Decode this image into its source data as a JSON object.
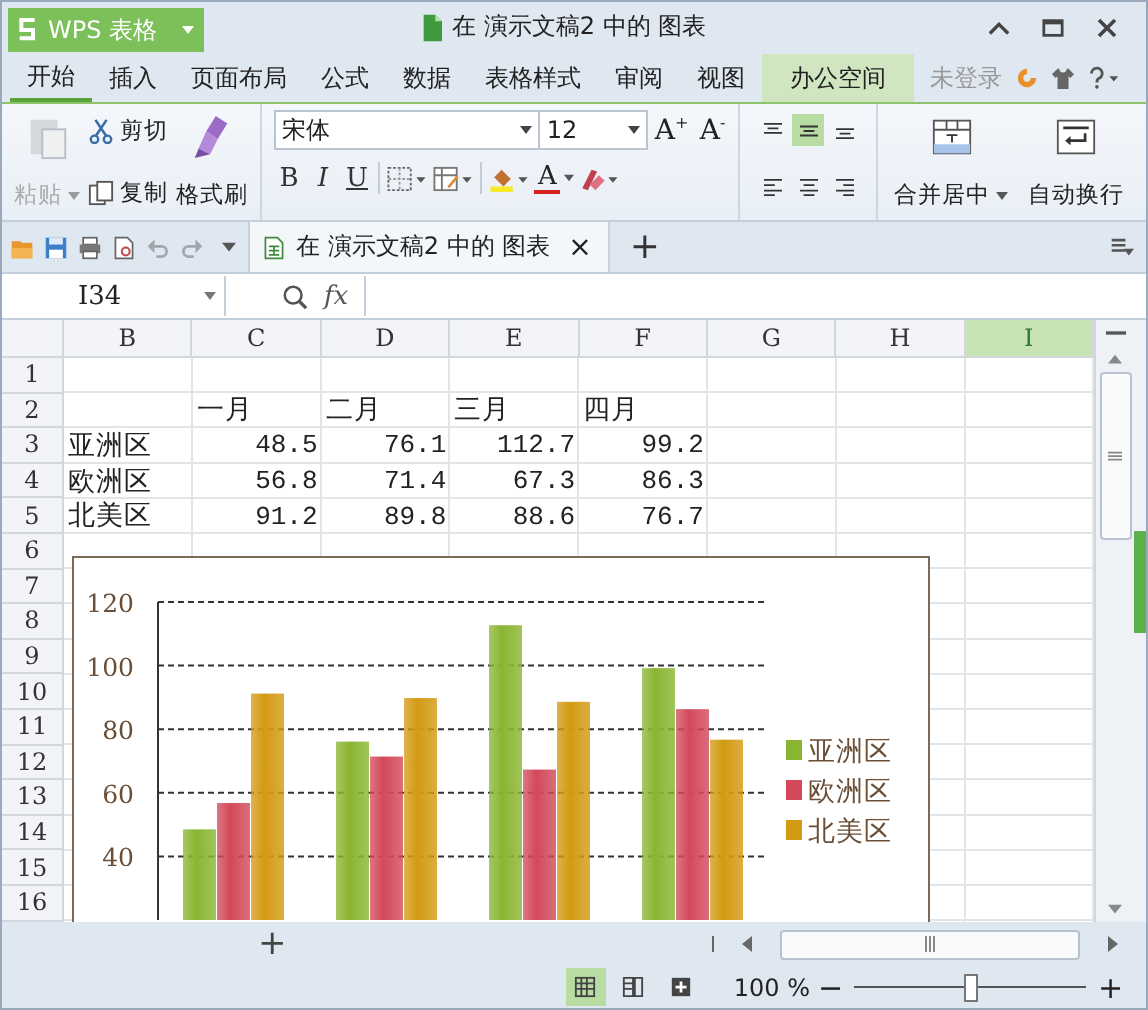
{
  "app_button": {
    "label": "WPS 表格"
  },
  "window": {
    "title": "在 演示文稿2 中的 图表"
  },
  "menu_tabs": [
    {
      "label": "开始",
      "selected": true,
      "highlighted": false
    },
    {
      "label": "插入",
      "selected": false,
      "highlighted": false
    },
    {
      "label": "页面布局",
      "selected": false,
      "highlighted": false
    },
    {
      "label": "公式",
      "selected": false,
      "highlighted": false
    },
    {
      "label": "数据",
      "selected": false,
      "highlighted": false
    },
    {
      "label": "表格样式",
      "selected": false,
      "highlighted": false
    },
    {
      "label": "审阅",
      "selected": false,
      "highlighted": false
    },
    {
      "label": "视图",
      "selected": false,
      "highlighted": false
    },
    {
      "label": "办公空间",
      "selected": false,
      "highlighted": true
    }
  ],
  "account": {
    "label": "未登录"
  },
  "ribbon": {
    "paste": {
      "label": "粘贴",
      "disabled": true
    },
    "cut": "剪切",
    "copy": "复制",
    "format_painter": "格式刷",
    "font": {
      "value": "宋体"
    },
    "font_size": {
      "value": "12"
    },
    "grow_font": "A$^{+}$",
    "shrink_font": "A$^{-}$",
    "bold": "B",
    "italic": "I",
    "underline": "U",
    "font_color": "A",
    "align_buttons": [
      {
        "kind": "top",
        "selected": false
      },
      {
        "kind": "middle",
        "selected": true
      },
      {
        "kind": "bottom",
        "selected": false
      },
      {
        "kind": "left",
        "selected": false
      },
      {
        "kind": "center",
        "selected": false
      },
      {
        "kind": "right",
        "selected": false
      }
    ],
    "merge": "合并居中",
    "wrap": "自动换行"
  },
  "quick_access": [
    {
      "kind": "open",
      "disabled": false
    },
    {
      "kind": "save",
      "disabled": false
    },
    {
      "kind": "print",
      "disabled": false
    },
    {
      "kind": "preview",
      "disabled": false
    },
    {
      "kind": "undo",
      "disabled": true
    },
    {
      "kind": "redo",
      "disabled": true
    }
  ],
  "doc_tab": {
    "title": "在 演示文稿2 中的 图表",
    "close": "×"
  },
  "new_tab": "+",
  "formula_bar": {
    "name_box": "I34",
    "fx": "fx"
  },
  "sheet": {
    "columns": [
      {
        "label": "B",
        "selected": false
      },
      {
        "label": "C",
        "selected": false
      },
      {
        "label": "D",
        "selected": false
      },
      {
        "label": "E",
        "selected": false
      },
      {
        "label": "F",
        "selected": false
      },
      {
        "label": "G",
        "selected": false
      },
      {
        "label": "H",
        "selected": false
      },
      {
        "label": "I",
        "selected": true
      }
    ],
    "rows": [
      "1",
      "2",
      "3",
      "4",
      "5",
      "6",
      "7",
      "8",
      "9",
      "10",
      "11",
      "12",
      "13",
      "14",
      "15",
      "16"
    ],
    "table": {
      "header": [
        "一月",
        "二月",
        "三月",
        "四月"
      ],
      "rows": [
        {
          "label": "亚洲区",
          "values": [
            "48.5",
            "76.1",
            "112.7",
            "99.2"
          ]
        },
        {
          "label": "欧洲区",
          "values": [
            "56.8",
            "71.4",
            "67.3",
            "86.3"
          ]
        },
        {
          "label": "北美区",
          "values": [
            "91.2",
            "89.8",
            "88.6",
            "76.7"
          ]
        }
      ]
    }
  },
  "chart": {
    "chart_data": {
      "type": "bar",
      "grid": true,
      "legend": "right",
      "ylim": [
        20,
        120
      ],
      "yticks": [
        40,
        60,
        80,
        100,
        120
      ],
      "series": [
        {
          "name": "亚洲区",
          "color": "#8ab531",
          "values": [
            48.5,
            76.1,
            112.7,
            99.2
          ]
        },
        {
          "name": "欧洲区",
          "color": "#d2495a",
          "values": [
            56.8,
            71.4,
            67.3,
            86.3
          ]
        },
        {
          "name": "北美区",
          "color": "#d39a12",
          "values": [
            91.2,
            89.8,
            88.6,
            76.7
          ]
        }
      ]
    }
  },
  "sheet_tabs": {
    "add": "+"
  },
  "status_bar": {
    "views": [
      {
        "kind": "normal",
        "selected": true
      },
      {
        "kind": "page",
        "selected": false
      },
      {
        "kind": "full",
        "selected": false
      }
    ],
    "zoom": "100 %",
    "zoom_out": "−",
    "zoom_in": "+",
    "zoom_slider": {
      "level": 0.5
    }
  }
}
